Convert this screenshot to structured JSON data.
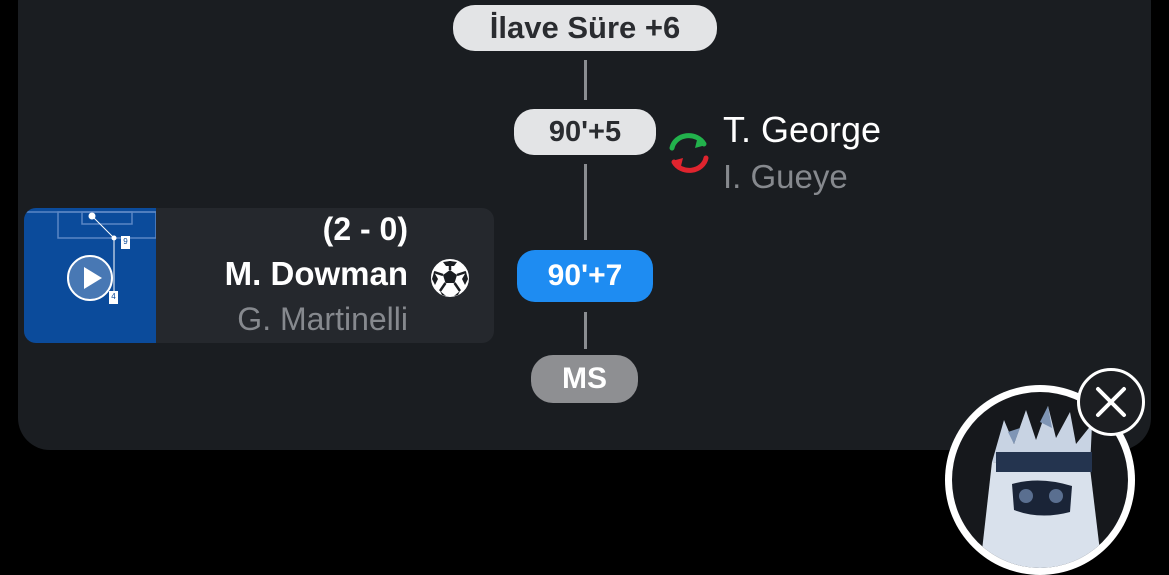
{
  "timeline": {
    "added_time_label": "İlave Süre +6",
    "end_label": "MS"
  },
  "substitution": {
    "minute": "90'+5",
    "player_in": "T. George",
    "player_out": "I. Gueye",
    "icon": "substitution-arrows-icon",
    "colors": {
      "in": "#22b24c",
      "out": "#e0242e"
    }
  },
  "goal": {
    "minute": "90'+7",
    "score": "(2 - 0)",
    "scorer": "M. Dowman",
    "assist": "G. Martinelli",
    "icon": "soccer-ball-icon",
    "pitch_markers": {
      "scorer_number": "9",
      "assist_number": "4"
    },
    "video_icon": "play-icon",
    "accent_color": "#1e8cf2"
  },
  "overlay": {
    "close_icon": "close-icon",
    "avatar": "mascot-avatar"
  }
}
